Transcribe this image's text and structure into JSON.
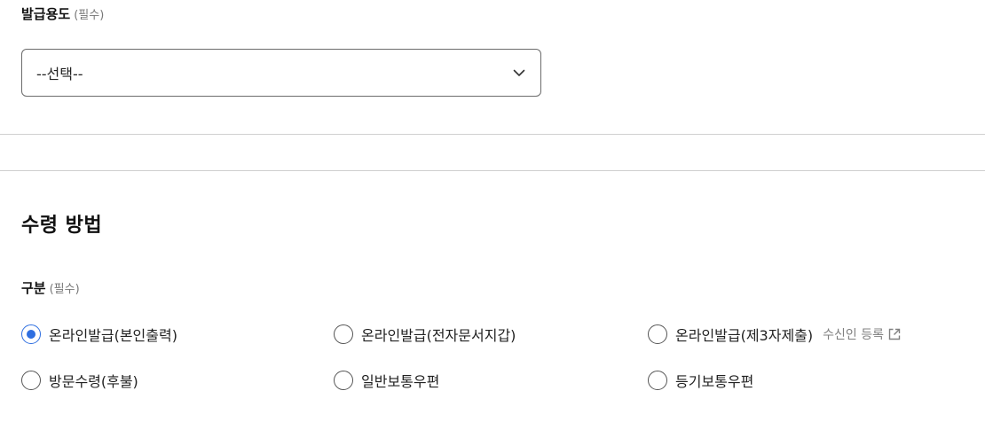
{
  "purpose": {
    "label": "발급용도",
    "required": "(필수)",
    "select_value": "--선택--",
    "chevron_icon": "chevron-down-icon"
  },
  "receipt": {
    "title": "수령 방법",
    "category_label": "구분",
    "category_required": "(필수)",
    "options": [
      {
        "label": "온라인발급(본인출력)",
        "checked": true
      },
      {
        "label": "온라인발급(전자문서지갑)",
        "checked": false
      },
      {
        "label": "온라인발급(제3자제출)",
        "checked": false
      },
      {
        "label": "방문수령(후불)",
        "checked": false
      },
      {
        "label": "일반보통우편",
        "checked": false
      },
      {
        "label": "등기보통우편",
        "checked": false
      }
    ],
    "recipient_link": "수신인 등록",
    "external_icon": "external-link-icon"
  },
  "colors": {
    "accent": "#2f6fe0",
    "border": "#6b6b6b",
    "divider": "#d0d0d0",
    "muted": "#808080"
  }
}
